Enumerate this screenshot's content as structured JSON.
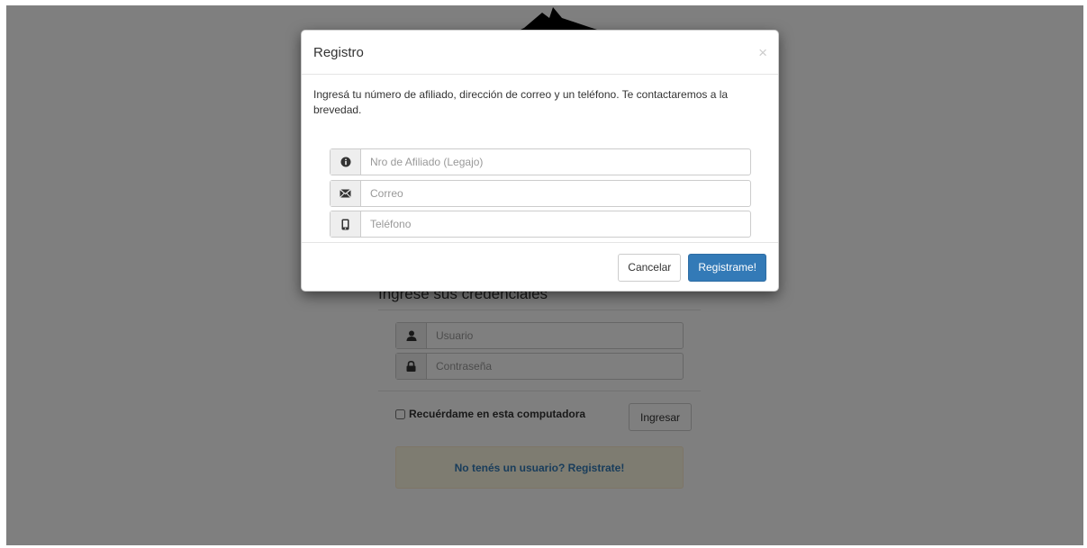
{
  "login": {
    "heading": "Ingrese sus credenciales",
    "username_placeholder": "Usuario",
    "password_placeholder": "Contraseña",
    "remember_label": "Recuérdame en esta computadora",
    "submit_label": "Ingresar",
    "register_link": "No tenés un usuario? Registrate!"
  },
  "modal": {
    "title": "Registro",
    "close_label": "×",
    "description": "Ingresá tu número de afiliado, dirección de correo y un teléfono. Te contactaremos a la brevedad.",
    "fields": [
      {
        "icon": "info-icon",
        "placeholder": "Nro de Afiliado (Legajo)"
      },
      {
        "icon": "envelope-icon",
        "placeholder": "Correo"
      },
      {
        "icon": "phone-icon",
        "placeholder": "Teléfono"
      }
    ],
    "cancel_label": "Cancelar",
    "submit_label": "Registrame!"
  },
  "colors": {
    "primary": "#337ab7",
    "warning_bg": "#fcf8e3",
    "backdrop": "rgba(0,0,0,0.5)"
  }
}
